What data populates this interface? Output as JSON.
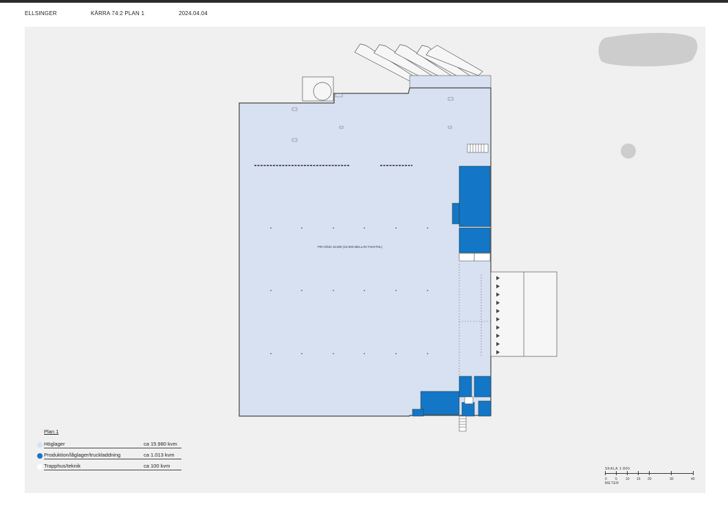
{
  "header": {
    "company": "ELLSINGER",
    "property": "KÄRRA 74:2  PLAN 1",
    "date": "2024.04.04"
  },
  "plan": {
    "note": "FRI HÖJD 10.800 (10.000 MELLAN TAKSTOL)"
  },
  "legend": {
    "title": "Plan 1",
    "items": [
      {
        "label": "Höglager",
        "area": "ca 15.980 kvm",
        "color": "#d8e1f1"
      },
      {
        "label": "Produktion/låglager/truckladdning",
        "area": "ca 1.013 kvm",
        "color": "#1476c6"
      },
      {
        "label": "Trapphus/teknik",
        "area": "ca 100 kvm",
        "color": "#ffffff"
      }
    ]
  },
  "scale": {
    "label": "SKALA 1:800",
    "unit": "METER",
    "ticks": [
      "0",
      "5",
      "10",
      "15",
      "20",
      "30",
      "40"
    ]
  },
  "colors": {
    "hoglager": "#d8e1f1",
    "produktion": "#1476c6",
    "outline": "#444444",
    "sheet": "#f0f0f1"
  }
}
